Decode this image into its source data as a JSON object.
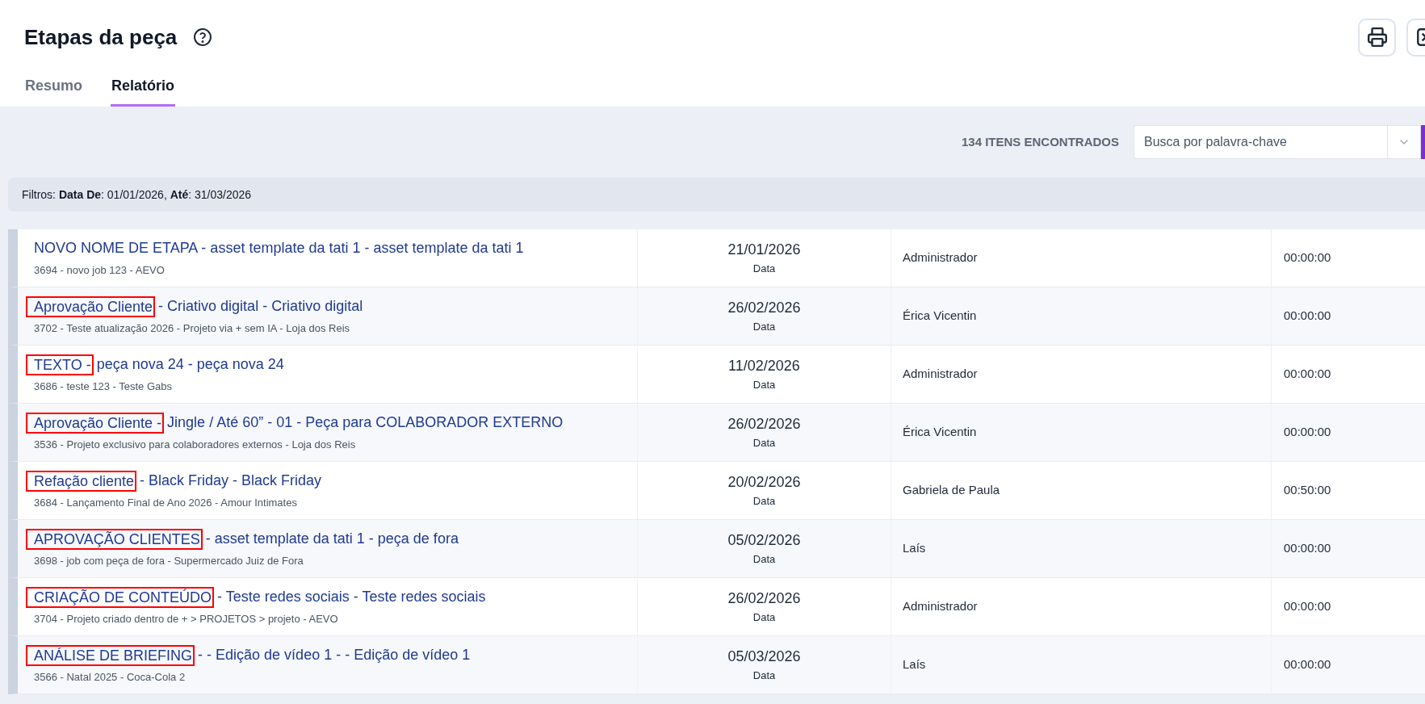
{
  "page": {
    "title": "Etapas da peça"
  },
  "tabs": [
    {
      "label": "Resumo",
      "selected": false
    },
    {
      "label": "Relatório",
      "selected": true
    }
  ],
  "results_count": "134 ITENS ENCONTRADOS",
  "search": {
    "placeholder": "Busca por palavra-chave"
  },
  "filters": "Filtros: **Data De**: 01/01/2026, **Até**: 31/03/2026",
  "rows": [
    {
      "boxed_label": null,
      "title": "NOVO NOME DE ETAPA - asset template da tati 1 - asset template da tati 1",
      "subtitle": "3694 - novo job 123 - AEVO",
      "date": "21/01/2026",
      "date_label": "Data",
      "user": "Administrador",
      "time": "00:00:00"
    },
    {
      "boxed_label": "Aprovação Cliente",
      "title": "- Criativo digital - Criativo digital",
      "subtitle": "3702 - Teste atualização 2026 - Projeto via + sem IA - Loja dos Reis",
      "date": "26/02/2026",
      "date_label": "Data",
      "user": "Érica Vicentin",
      "time": "00:00:00"
    },
    {
      "boxed_label": "TEXTO -",
      "title": "peça nova 24 - peça nova 24",
      "subtitle": "3686 - teste 123 - Teste Gabs",
      "date": "11/02/2026",
      "date_label": "Data",
      "user": "Administrador",
      "time": "00:00:00"
    },
    {
      "boxed_label": "Aprovação Cliente -",
      "title": "Jingle / Até 60” - 01 - Peça para COLABORADOR EXTERNO",
      "subtitle": "3536 - Projeto exclusivo para colaboradores externos - Loja dos Reis",
      "date": "26/02/2026",
      "date_label": "Data",
      "user": "Érica Vicentin",
      "time": "00:00:00"
    },
    {
      "boxed_label": "Refação cliente",
      "title": "- Black Friday - Black Friday",
      "subtitle": "3684 - Lançamento Final de Ano 2026 - Amour Intimates",
      "date": "20/02/2026",
      "date_label": "Data",
      "user": "Gabriela de Paula",
      "time": "00:50:00"
    },
    {
      "boxed_label": "APROVAÇÃO CLIENTES",
      "title": "- asset template da tati 1 - peça de fora",
      "subtitle": "3698 - job com peça de fora - Supermercado Juiz de Fora",
      "date": "05/02/2026",
      "date_label": "Data",
      "user": "Laís",
      "time": "00:00:00"
    },
    {
      "boxed_label": "CRIAÇÃO DE CONTEÚDO",
      "title": "- Teste redes sociais - Teste redes sociais",
      "subtitle": "3704 - Projeto criado dentro de + > PROJETOS > projeto - AEVO",
      "date": "26/02/2026",
      "date_label": "Data",
      "user": "Administrador",
      "time": "00:00:00"
    },
    {
      "boxed_label": "ANÁLISE DE BRIEFING",
      "title": "- - Edição de vídeo 1 - - Edição de vídeo 1",
      "subtitle": "3566 - Natal 2025 - Coca-Cola 2",
      "date": "05/03/2026",
      "date_label": "Data",
      "user": "Laís",
      "time": "00:00:00"
    }
  ]
}
